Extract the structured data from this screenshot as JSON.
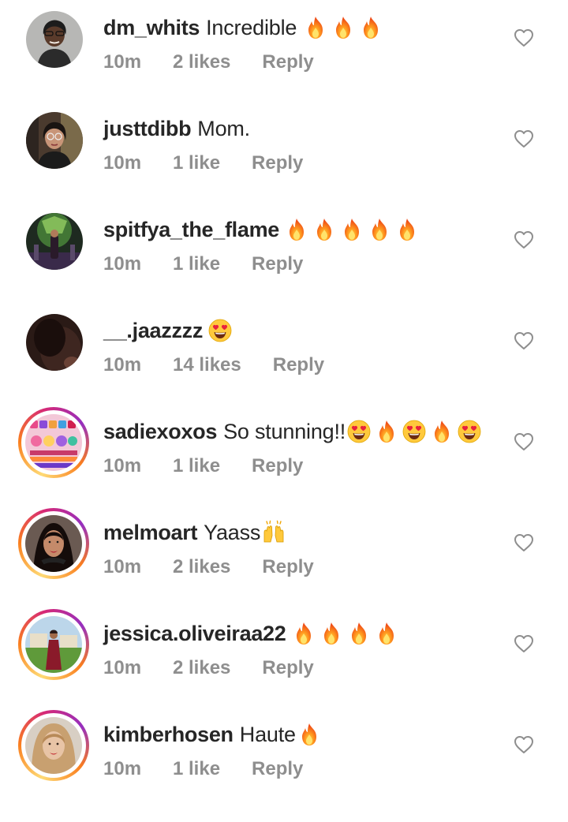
{
  "colors": {
    "text": "#262626",
    "meta": "#8e8e8e",
    "background": "#ffffff"
  },
  "comments": [
    {
      "username": "dm_whits",
      "text": "Incredible",
      "emojis": [
        "fire-emoji",
        "fire-emoji",
        "fire-emoji"
      ],
      "time": "10m",
      "likes": "2 likes",
      "reply": "Reply",
      "story_ring": false,
      "avatar": "avatar-woman-gray-background"
    },
    {
      "username": "justtdibb",
      "text": "Mom.",
      "emojis": [],
      "time": "10m",
      "likes": "1 like",
      "reply": "Reply",
      "story_ring": false,
      "avatar": "avatar-woman-glasses"
    },
    {
      "username": "spitfya_the_flame",
      "text": "",
      "emojis": [
        "fire-emoji",
        "fire-emoji",
        "fire-emoji",
        "fire-emoji",
        "fire-emoji"
      ],
      "time": "10m",
      "likes": "1 like",
      "reply": "Reply",
      "story_ring": false,
      "avatar": "avatar-performer-green-stage"
    },
    {
      "username": "__.jaazzzz",
      "text": "",
      "emojis": [
        "heart-eyes-emoji"
      ],
      "time": "10m",
      "likes": "14 likes",
      "reply": "Reply",
      "story_ring": false,
      "avatar": "avatar-dark-hair-closeup"
    },
    {
      "username": "sadiexoxos",
      "text": "So stunning!!",
      "emojis": [
        "heart-eyes-emoji",
        "fire-emoji",
        "heart-eyes-emoji",
        "fire-emoji",
        "heart-eyes-emoji"
      ],
      "time": "10m",
      "likes": "1 like",
      "reply": "Reply",
      "story_ring": true,
      "avatar": "avatar-makeup-palette"
    },
    {
      "username": "melmoart",
      "text": "Yaass",
      "emojis": [
        "raising-hands-emoji"
      ],
      "time": "10m",
      "likes": "2 likes",
      "reply": "Reply",
      "story_ring": true,
      "avatar": "avatar-woman-red-lips"
    },
    {
      "username": "jessica.oliveiraa22",
      "text": "",
      "emojis": [
        "fire-emoji",
        "fire-emoji",
        "fire-emoji",
        "fire-emoji"
      ],
      "time": "10m",
      "likes": "2 likes",
      "reply": "Reply",
      "story_ring": true,
      "avatar": "avatar-woman-red-dress-outdoors"
    },
    {
      "username": "kimberhosen",
      "text": "Haute",
      "emojis": [
        "fire-emoji"
      ],
      "time": "10m",
      "likes": "1 like",
      "reply": "Reply",
      "story_ring": true,
      "avatar": "avatar-woman-blonde"
    }
  ]
}
